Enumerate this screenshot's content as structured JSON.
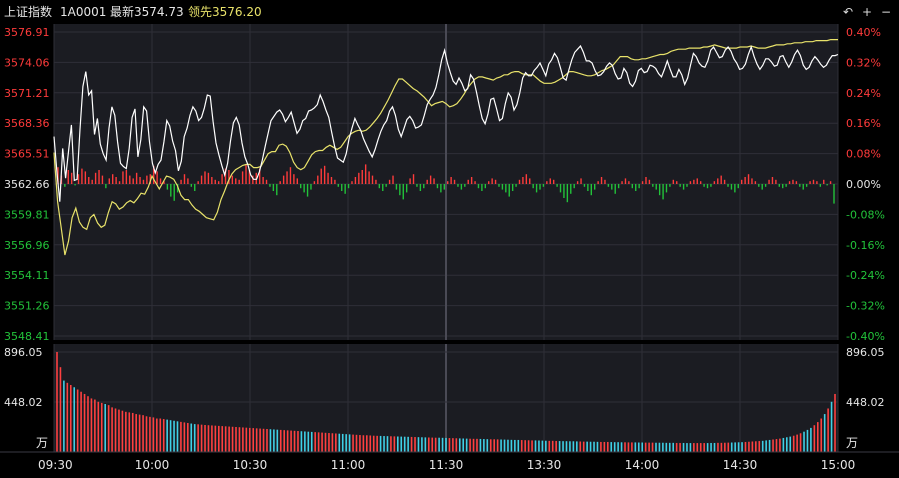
{
  "header": {
    "index_name": "上证指数",
    "code": "1A0001",
    "latest": "最新3574.73",
    "leader": "领先3576.20",
    "controls": [
      "↶",
      "+",
      "−"
    ]
  },
  "colors": {
    "up": "#ff3b3b",
    "down": "#22c33a",
    "flat": "#e6e6e6",
    "price_line": "#ffffff",
    "leader_line": "#e8e26a",
    "vol_up": "#ff4040",
    "vol_down": "#3fd0e6",
    "grid": "#2f2f38",
    "bg": "#1b1c22"
  },
  "chart_data": {
    "type": "line",
    "prev_close": 3562.66,
    "price_axis": {
      "ticks": [
        "3576.91",
        "3574.06",
        "3571.21",
        "3568.36",
        "3565.51",
        "3562.66",
        "3559.81",
        "3556.96",
        "3554.11",
        "3551.26",
        "3548.41"
      ],
      "range": [
        3548.41,
        3576.91
      ]
    },
    "pct_axis": {
      "ticks": [
        "0.40%",
        "0.32%",
        "0.24%",
        "0.16%",
        "0.08%",
        "0.00%",
        "-0.08%",
        "-0.16%",
        "-0.24%",
        "-0.32%",
        "-0.40%"
      ]
    },
    "time_labels": [
      "09:30",
      "10:00",
      "10:30",
      "11:00",
      "11:30",
      "13:30",
      "14:00",
      "14:30",
      "15:00"
    ],
    "volume_axis": {
      "ticks": [
        "896.05",
        "448.02"
      ],
      "unit": "万",
      "max": 896.05
    },
    "series": [
      {
        "name": "最新",
        "values": [
          3567.1,
          3563.8,
          3561.0,
          3566.0,
          3563.2,
          3565.7,
          3568.2,
          3563.0,
          3563.1,
          3567.8,
          3571.8,
          3573.2,
          3571.0,
          3571.4,
          3567.3,
          3568.8,
          3566.4,
          3565.5,
          3564.9,
          3567.9,
          3569.9,
          3569.1,
          3566.6,
          3564.6,
          3564.3,
          3564.1,
          3566.0,
          3568.9,
          3569.7,
          3565.2,
          3566.8,
          3569.9,
          3569.5,
          3566.6,
          3564.6,
          3563.7,
          3564.5,
          3564.9,
          3566.6,
          3568.6,
          3568.1,
          3566.7,
          3565.8,
          3563.9,
          3564.8,
          3567.1,
          3567.9,
          3569.1,
          3569.9,
          3569.5,
          3568.6,
          3568.9,
          3569.8,
          3571.0,
          3570.9,
          3568.5,
          3566.5,
          3565.4,
          3564.4,
          3563.5,
          3564.6,
          3566.7,
          3568.4,
          3568.9,
          3568.2,
          3566.5,
          3565.2,
          3564.5,
          3563.5,
          3563.1,
          3563.1,
          3563.8,
          3564.9,
          3566.2,
          3567.4,
          3568.6,
          3569.0,
          3569.4,
          3569.6,
          3569.2,
          3568.5,
          3568.9,
          3569.4,
          3568.4,
          3567.4,
          3567.8,
          3568.6,
          3568.8,
          3569.5,
          3569.6,
          3569.8,
          3570.1,
          3571.0,
          3570.4,
          3569.6,
          3568.9,
          3567.5,
          3566.2,
          3565.1,
          3564.9,
          3564.7,
          3565.5,
          3566.9,
          3567.9,
          3568.8,
          3568.2,
          3567.7,
          3566.9,
          3566.3,
          3565.7,
          3565.2,
          3565.9,
          3566.8,
          3567.6,
          3568.2,
          3568.6,
          3569.5,
          3569.9,
          3569.1,
          3567.8,
          3567.1,
          3567.9,
          3568.7,
          3569.0,
          3568.6,
          3567.9,
          3568.0,
          3568.2,
          3569.1,
          3570.1,
          3570.6,
          3571.0,
          3571.7,
          3572.9,
          3574.3,
          3575.2,
          3574.0,
          3573.1,
          3572.3,
          3572.0,
          3572.6,
          3572.1,
          3571.4,
          3571.6,
          3572.9,
          3572.5,
          3571.3,
          3570.0,
          3568.8,
          3568.3,
          3569.2,
          3570.6,
          3570.7,
          3569.7,
          3568.6,
          3568.8,
          3570.2,
          3571.2,
          3570.8,
          3569.6,
          3570.1,
          3571.2,
          3572.6,
          3573.1,
          3572.8,
          3572.8,
          3573.3,
          3573.6,
          3574.0,
          3573.4,
          3572.8,
          3573.9,
          3574.3,
          3574.9,
          3574.5,
          3573.6,
          3572.6,
          3572.4,
          3573.4,
          3574.3,
          3575.0,
          3575.3,
          3575.6,
          3575.0,
          3574.2,
          3574.2,
          3574.0,
          3573.3,
          3572.8,
          3572.9,
          3573.2,
          3573.7,
          3574.0,
          3573.8,
          3573.0,
          3572.5,
          3572.6,
          3573.5,
          3573.1,
          3572.1,
          3571.8,
          3572.3,
          3573.3,
          3573.5,
          3573.1,
          3573.2,
          3573.8,
          3573.7,
          3573.5,
          3573.0,
          3572.7,
          3573.4,
          3574.2,
          3573.4,
          3572.7,
          3572.7,
          3573.4,
          3572.9,
          3572.0,
          3572.6,
          3573.8,
          3574.9,
          3574.6,
          3574.0,
          3573.7,
          3573.6,
          3574.2,
          3575.2,
          3575.5,
          3575.0,
          3574.5,
          3574.6,
          3575.2,
          3575.5,
          3575.1,
          3574.4,
          3574.0,
          3573.4,
          3573.5,
          3573.9,
          3574.8,
          3575.5,
          3574.6,
          3573.9,
          3573.4,
          3573.8,
          3574.4,
          3574.4,
          3574.1,
          3573.7,
          3573.8,
          3574.6,
          3574.7,
          3574.1,
          3573.6,
          3574.1,
          3574.8,
          3575.2,
          3574.7,
          3573.8,
          3573.4,
          3573.6,
          3574.2,
          3574.6,
          3574.3,
          3573.9,
          3573.6,
          3573.8,
          3574.3,
          3574.7,
          3574.7,
          3574.8
        ],
        "color": "white"
      },
      {
        "name": "领先",
        "values": [
          3565.6,
          3561.0,
          3558.5,
          3556.0,
          3557.3,
          3559.5,
          3560.4,
          3559.1,
          3558.6,
          3558.4,
          3559.5,
          3559.8,
          3559.0,
          3558.6,
          3558.8,
          3560.0,
          3561.0,
          3560.8,
          3560.3,
          3560.5,
          3560.9,
          3561.1,
          3560.9,
          3561.3,
          3561.8,
          3561.7,
          3562.4,
          3563.4,
          3562.8,
          3562.2,
          3562.8,
          3563.4,
          3563.3,
          3563.1,
          3562.5,
          3561.6,
          3561.2,
          3561.2,
          3560.7,
          3560.3,
          3560.1,
          3559.8,
          3559.5,
          3559.4,
          3559.3,
          3560.0,
          3561.2,
          3562.0,
          3562.9,
          3563.6,
          3564.0,
          3564.2,
          3564.4,
          3564.5,
          3564.5,
          3564.2,
          3564.2,
          3564.3,
          3564.9,
          3565.5,
          3565.7,
          3565.7,
          3566.3,
          3566.4,
          3566.2,
          3565.6,
          3564.7,
          3564.2,
          3564.0,
          3564.2,
          3564.8,
          3565.4,
          3565.7,
          3565.8,
          3565.8,
          3566.1,
          3566.3,
          3566.1,
          3565.9,
          3566.1,
          3566.6,
          3567.1,
          3567.4,
          3567.6,
          3567.7,
          3567.6,
          3567.7,
          3568.0,
          3568.4,
          3568.8,
          3569.3,
          3569.9,
          3570.5,
          3571.2,
          3571.9,
          3572.5,
          3572.5,
          3572.2,
          3571.9,
          3571.6,
          3571.4,
          3571.1,
          3570.8,
          3570.4,
          3570.0,
          3570.2,
          3570.3,
          3570.4,
          3570.2,
          3569.9,
          3570.0,
          3570.2,
          3570.6,
          3571.1,
          3571.7,
          3572.1,
          3572.5,
          3572.7,
          3572.7,
          3572.6,
          3572.5,
          3572.4,
          3572.6,
          3572.7,
          3572.9,
          3572.9,
          3573.1,
          3573.2,
          3573.2,
          3573.0,
          3572.9,
          3572.9,
          3572.9,
          3572.6,
          3572.3,
          3572.1,
          3572.1,
          3572.1,
          3572.2,
          3572.4,
          3572.6,
          3572.9,
          3573.2,
          3573.2,
          3573.1,
          3573.0,
          3572.9,
          3572.8,
          3572.8,
          3572.9,
          3573.1,
          3573.3,
          3573.4,
          3573.6,
          3573.8,
          3574.2,
          3574.6,
          3574.6,
          3574.6,
          3574.4,
          3574.3,
          3574.3,
          3574.4,
          3574.4,
          3574.5,
          3574.6,
          3574.7,
          3574.8,
          3574.8,
          3574.9,
          3575.1,
          3575.2,
          3575.3,
          3575.3,
          3575.3,
          3575.4,
          3575.4,
          3575.4,
          3575.4,
          3575.5,
          3575.5,
          3575.6,
          3575.7,
          3575.6,
          3575.5,
          3575.4,
          3575.4,
          3575.4,
          3575.4,
          3575.5,
          3575.5,
          3575.5,
          3575.6,
          3575.5,
          3575.4,
          3575.4,
          3575.4,
          3575.5,
          3575.6,
          3575.7,
          3575.7,
          3575.7,
          3575.8,
          3575.8,
          3575.9,
          3575.9,
          3575.9,
          3576.0,
          3576.0,
          3576.0,
          3576.1,
          3576.1,
          3576.1,
          3576.1,
          3576.2,
          3576.2,
          3576.2
        ],
        "color": "yellow"
      }
    ],
    "delta_bars": [
      1.2,
      0.6,
      -0.2,
      1.0,
      0.8,
      -0.1,
      0.7,
      1.1,
      0.9,
      0.5,
      0.3,
      0.8,
      1.0,
      0.6,
      -0.3,
      0.4,
      0.7,
      0.5,
      0.2,
      0.9,
      1.0,
      0.6,
      0.4,
      0.8,
      0.5,
      0.3,
      0.6,
      0.7,
      1.3,
      0.9,
      0.4,
      0.2,
      -0.4,
      -0.9,
      -1.2,
      -0.6,
      0.3,
      0.7,
      0.4,
      -0.2,
      -0.5,
      0.2,
      0.6,
      0.9,
      0.8,
      0.5,
      0.3,
      0.2,
      0.7,
      1.1,
      1.0,
      0.6,
      0.4,
      0.3,
      0.9,
      1.4,
      1.0,
      0.6,
      0.8,
      1.1,
      0.5,
      0.3,
      -0.2,
      -0.5,
      -0.8,
      0.2,
      0.6,
      0.9,
      1.2,
      0.7,
      0.4,
      -0.3,
      -0.6,
      -0.9,
      -0.4,
      0.2,
      0.6,
      1.1,
      1.3,
      0.8,
      0.5,
      0.3,
      -0.2,
      -0.5,
      -0.7,
      -0.3,
      0.2,
      0.5,
      0.8,
      1.0,
      1.4,
      0.9,
      0.6,
      0.3,
      -0.3,
      -0.5,
      -0.2,
      0.3,
      0.6,
      -0.4,
      -0.8,
      -1.1,
      -0.6,
      0.4,
      0.7,
      -0.2,
      -0.5,
      -0.3,
      0.3,
      0.6,
      0.4,
      -0.3,
      -0.6,
      -0.4,
      0.2,
      0.5,
      0.3,
      -0.2,
      -0.4,
      -0.2,
      0.3,
      0.5,
      0.2,
      -0.3,
      -0.5,
      -0.3,
      0.2,
      0.4,
      0.3,
      -0.2,
      -0.4,
      -0.6,
      -0.9,
      -0.5,
      -0.2,
      0.3,
      0.5,
      0.7,
      0.4,
      -0.3,
      -0.6,
      -0.4,
      -0.2,
      0.2,
      0.4,
      0.3,
      -0.2,
      -0.6,
      -1.0,
      -1.3,
      -0.7,
      -0.3,
      0.2,
      0.4,
      -0.2,
      -0.5,
      -0.8,
      -0.4,
      0.2,
      0.5,
      0.3,
      -0.2,
      -0.4,
      -0.7,
      -0.3,
      0.2,
      0.4,
      0.2,
      -0.3,
      -0.5,
      -0.3,
      0.2,
      0.5,
      0.3,
      -0.2,
      -0.4,
      -0.8,
      -1.1,
      -0.6,
      -0.2,
      0.3,
      0.2,
      -0.2,
      -0.4,
      -0.2,
      0.2,
      0.3,
      0.4,
      0.2,
      -0.2,
      -0.3,
      -0.2,
      0.2,
      0.4,
      0.6,
      0.3,
      -0.2,
      -0.4,
      -0.6,
      -0.3,
      0.3,
      0.5,
      0.7,
      0.4,
      0.2,
      -0.2,
      -0.4,
      -0.2,
      0.3,
      0.5,
      0.3,
      -0.2,
      -0.3,
      -0.2,
      0.2,
      0.3,
      0.2,
      -0.2,
      -0.4,
      -0.2,
      0.2,
      0.3,
      0.2,
      -0.2,
      0.3,
      -0.1,
      0.2,
      -1.4
    ],
    "volume": [
      896,
      760,
      640,
      620,
      600,
      580,
      560,
      540,
      520,
      500,
      480,
      470,
      450,
      440,
      430,
      420,
      400,
      390,
      380,
      370,
      360,
      355,
      350,
      340,
      335,
      330,
      320,
      315,
      310,
      300,
      300,
      295,
      290,
      285,
      280,
      275,
      270,
      265,
      260,
      255,
      250,
      248,
      245,
      242,
      240,
      238,
      236,
      234,
      232,
      230,
      228,
      226,
      224,
      222,
      220,
      218,
      216,
      214,
      212,
      210,
      208,
      206,
      204,
      202,
      200,
      198,
      196,
      194,
      192,
      190,
      188,
      186,
      184,
      182,
      180,
      178,
      176,
      174,
      172,
      170,
      168,
      166,
      164,
      162,
      160,
      158,
      156,
      154,
      152,
      150,
      150,
      148,
      146,
      145,
      144,
      143,
      142,
      141,
      140,
      139,
      138,
      137,
      136,
      135,
      134,
      133,
      132,
      131,
      130,
      129,
      128,
      128,
      127,
      126,
      125,
      124,
      123,
      122,
      121,
      120,
      119,
      118,
      118,
      117,
      116,
      115,
      114,
      114,
      113,
      112,
      111,
      110,
      109,
      108,
      108,
      107,
      106,
      105,
      104,
      104,
      103,
      102,
      101,
      100,
      100,
      99,
      98,
      97,
      97,
      96,
      96,
      95,
      94,
      93,
      93,
      92,
      92,
      91,
      90,
      90,
      90,
      89,
      88,
      88,
      87,
      87,
      86,
      86,
      86,
      85,
      85,
      84,
      84,
      84,
      83,
      83,
      83,
      82,
      82,
      82,
      81,
      81,
      81,
      80,
      80,
      80,
      80,
      80,
      80,
      80,
      81,
      81,
      82,
      82,
      83,
      84,
      85,
      86,
      87,
      88,
      90,
      92,
      94,
      96,
      98,
      100,
      104,
      108,
      112,
      116,
      120,
      126,
      132,
      138,
      146,
      156,
      168,
      182,
      198,
      216,
      240,
      268,
      300,
      340,
      390,
      450,
      520
    ],
    "volume_up": [
      1,
      1,
      0,
      1,
      1,
      0,
      1,
      1,
      1,
      1,
      1,
      1,
      1,
      1,
      0,
      1,
      1,
      1,
      1,
      1,
      1,
      1,
      1,
      1,
      1,
      1,
      1,
      1,
      1,
      1,
      1,
      1,
      0,
      0,
      0,
      0,
      1,
      1,
      1,
      0,
      0,
      1,
      1,
      1,
      1,
      1,
      1,
      1,
      1,
      1,
      1,
      1,
      1,
      1,
      1,
      1,
      1,
      1,
      1,
      1,
      1,
      1,
      0,
      0,
      0,
      1,
      1,
      1,
      1,
      1,
      1,
      0,
      0,
      0,
      0,
      1,
      1,
      1,
      1,
      1,
      1,
      1,
      0,
      0,
      0,
      0,
      1,
      1,
      1,
      1,
      1,
      1,
      1,
      1,
      0,
      0,
      0,
      1,
      1,
      0,
      0,
      0,
      0,
      1,
      1,
      0,
      0,
      0,
      1,
      1,
      1,
      0,
      0,
      0,
      1,
      1,
      1,
      0,
      0,
      0,
      1,
      1,
      1,
      0,
      0,
      0,
      1,
      1,
      1,
      0,
      0,
      0,
      0,
      0,
      0,
      1,
      1,
      1,
      1,
      0,
      0,
      0,
      0,
      1,
      1,
      1,
      0,
      0,
      0,
      0,
      0,
      0,
      1,
      1,
      0,
      0,
      0,
      0,
      1,
      1,
      1,
      0,
      0,
      0,
      0,
      1,
      1,
      1,
      0,
      0,
      0,
      1,
      1,
      1,
      0,
      0,
      0,
      0,
      0,
      0,
      1,
      1,
      0,
      0,
      0,
      1,
      1,
      1,
      1,
      0,
      0,
      0,
      1,
      1,
      1,
      1,
      0,
      0,
      0,
      0,
      1,
      1,
      1,
      1,
      1,
      0,
      0,
      0,
      1,
      1,
      1,
      0,
      0,
      0,
      1,
      1,
      1,
      0,
      0,
      0,
      1,
      1,
      1,
      0,
      1,
      0,
      1,
      0
    ]
  }
}
